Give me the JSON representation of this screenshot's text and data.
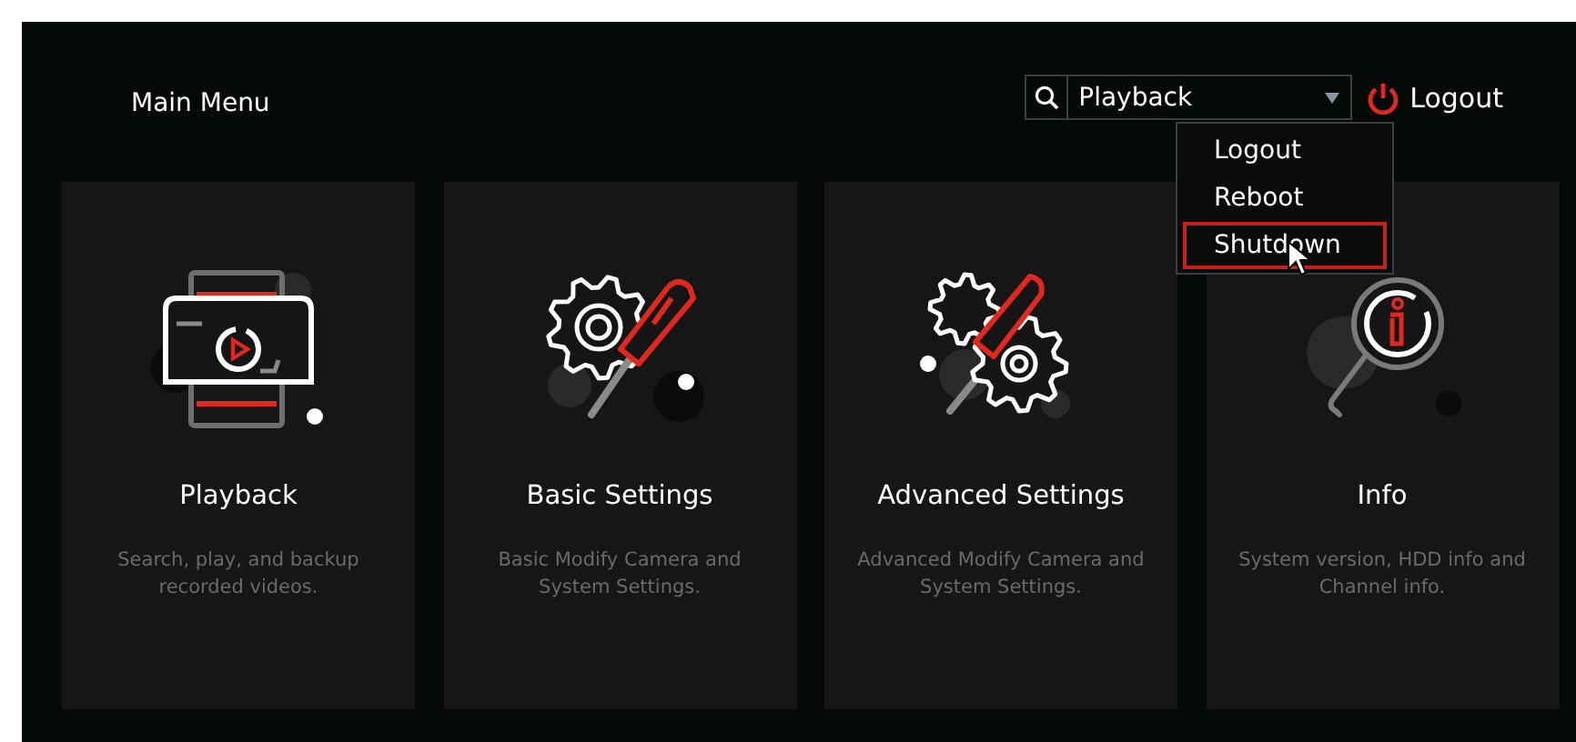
{
  "header": {
    "title": "Main Menu"
  },
  "search": {
    "value": "Playback"
  },
  "logout_button": {
    "label": "Logout"
  },
  "logout_menu": [
    {
      "label": "Logout",
      "selected": false
    },
    {
      "label": "Reboot",
      "selected": false
    },
    {
      "label": "Shutdown",
      "selected": true
    }
  ],
  "cards": [
    {
      "kind": "playback",
      "title": "Playback",
      "description": "Search, play, and backup recorded videos."
    },
    {
      "kind": "basic-settings",
      "title": "Basic Settings",
      "description": "Basic Modify Camera and System Settings."
    },
    {
      "kind": "advanced-settings",
      "title": "Advanced Settings",
      "description": "Advanced Modify Camera and System Settings."
    },
    {
      "kind": "info",
      "title": "Info",
      "description": "System version, HDD info and Channel info."
    }
  ]
}
